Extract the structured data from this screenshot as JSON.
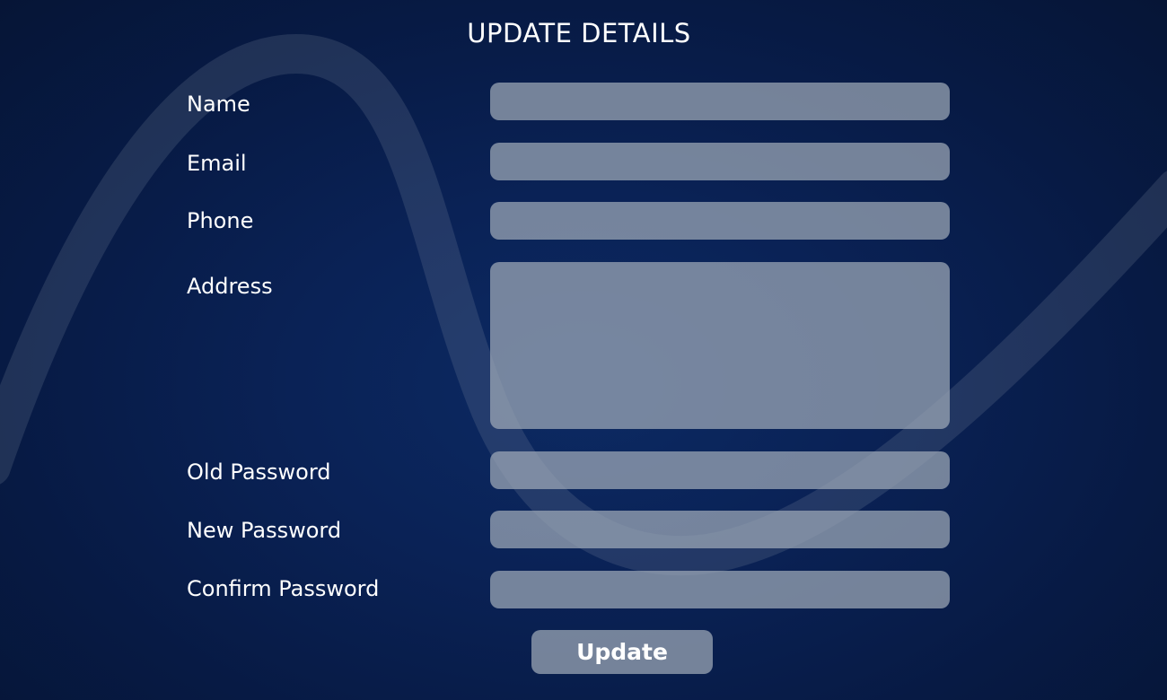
{
  "page": {
    "title": "UPDATE DETAILS"
  },
  "form": {
    "fields": [
      {
        "label": "Name",
        "value": "",
        "placeholder": ""
      },
      {
        "label": "Email",
        "value": "",
        "placeholder": ""
      },
      {
        "label": "Phone",
        "value": "",
        "placeholder": ""
      },
      {
        "label": "Address",
        "value": "",
        "placeholder": ""
      },
      {
        "label": "Old Password",
        "value": "",
        "placeholder": ""
      },
      {
        "label": "New Password",
        "value": "",
        "placeholder": ""
      },
      {
        "label": "Confirm Password",
        "value": "",
        "placeholder": ""
      }
    ],
    "submit_label": "Update"
  },
  "colors": {
    "background": "#0a2256",
    "field_fill": "#8a93a6",
    "text": "#ffffff"
  }
}
